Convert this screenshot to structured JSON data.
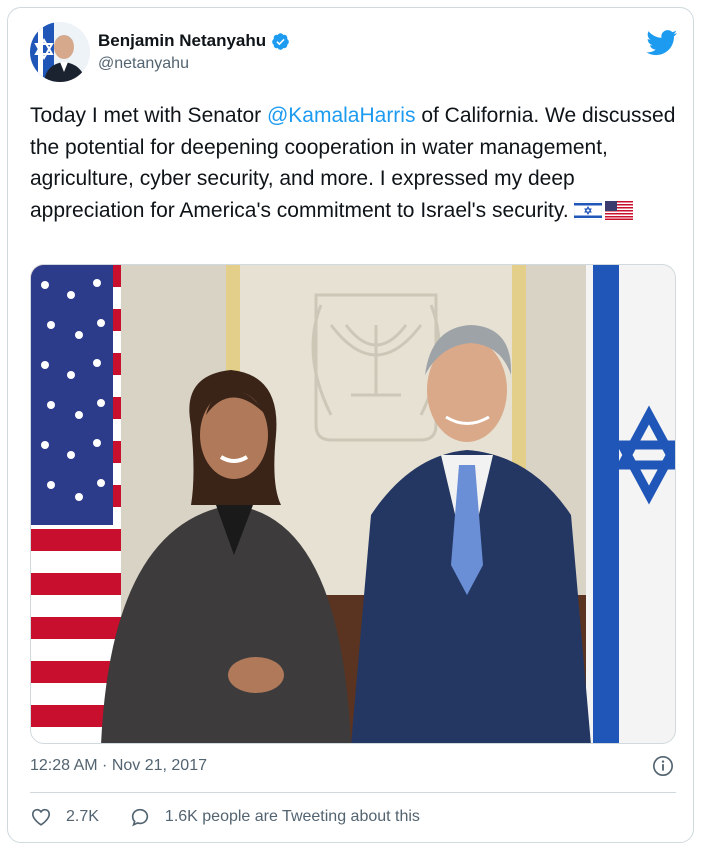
{
  "author": {
    "display_name": "Benjamin Netanyahu",
    "handle": "@netanyahu",
    "verified": true
  },
  "tweet": {
    "text_before": "Today I met with Senator ",
    "mention": "@KamalaHarris",
    "text_after": " of California. We discussed the potential for deepening cooperation in water management, agriculture, cyber security, and more. I expressed my deep appreciation for America's commitment to Israel's security. ",
    "emojis": [
      "israel-flag",
      "us-flag"
    ],
    "timestamp": "12:28 AM · Nov 21, 2017"
  },
  "actions": {
    "likes": "2.7K",
    "conversation": "1.6K people are Tweeting about this"
  },
  "icons": {
    "brand": "twitter-bird-icon",
    "verified": "verified-badge-icon",
    "info": "info-icon",
    "like": "heart-icon",
    "reply": "speech-bubble-icon"
  },
  "colors": {
    "accent": "#1d9bf0",
    "text": "#0f1419",
    "secondary": "#536471",
    "border": "#cfd9de"
  }
}
